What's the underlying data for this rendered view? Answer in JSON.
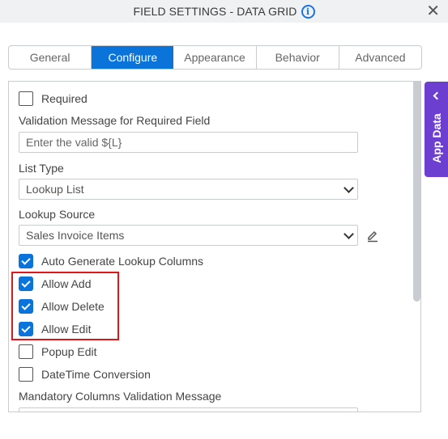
{
  "header": {
    "title": "FIELD SETTINGS - DATA GRID",
    "info_icon": "i",
    "close_icon": "✕"
  },
  "tabs": [
    {
      "label": "General",
      "active": false
    },
    {
      "label": "Configure",
      "active": true
    },
    {
      "label": "Appearance",
      "active": false
    },
    {
      "label": "Behavior",
      "active": false
    },
    {
      "label": "Advanced",
      "active": false
    }
  ],
  "form": {
    "required": {
      "label": "Required",
      "checked": false
    },
    "validation_message": {
      "label": "Validation Message for Required Field",
      "placeholder": "Enter the valid ${L}",
      "value": ""
    },
    "list_type": {
      "label": "List Type",
      "value": "Lookup List"
    },
    "lookup_source": {
      "label": "Lookup Source",
      "value": "Sales Invoice Items"
    },
    "auto_generate": {
      "label": "Auto Generate Lookup Columns",
      "checked": true
    },
    "allow_add": {
      "label": "Allow Add",
      "checked": true
    },
    "allow_delete": {
      "label": "Allow Delete",
      "checked": true
    },
    "allow_edit": {
      "label": "Allow Edit",
      "checked": true
    },
    "popup_edit": {
      "label": "Popup Edit",
      "checked": false
    },
    "datetime_conversion": {
      "label": "DateTime Conversion",
      "checked": false
    },
    "mandatory_columns": {
      "label": "Mandatory Columns Validation Message",
      "value": ""
    }
  },
  "side_panel": {
    "label": "App Data"
  },
  "colors": {
    "accent": "#0a74da",
    "side_panel": "#6c3fd1",
    "highlight": "#e0161b"
  }
}
